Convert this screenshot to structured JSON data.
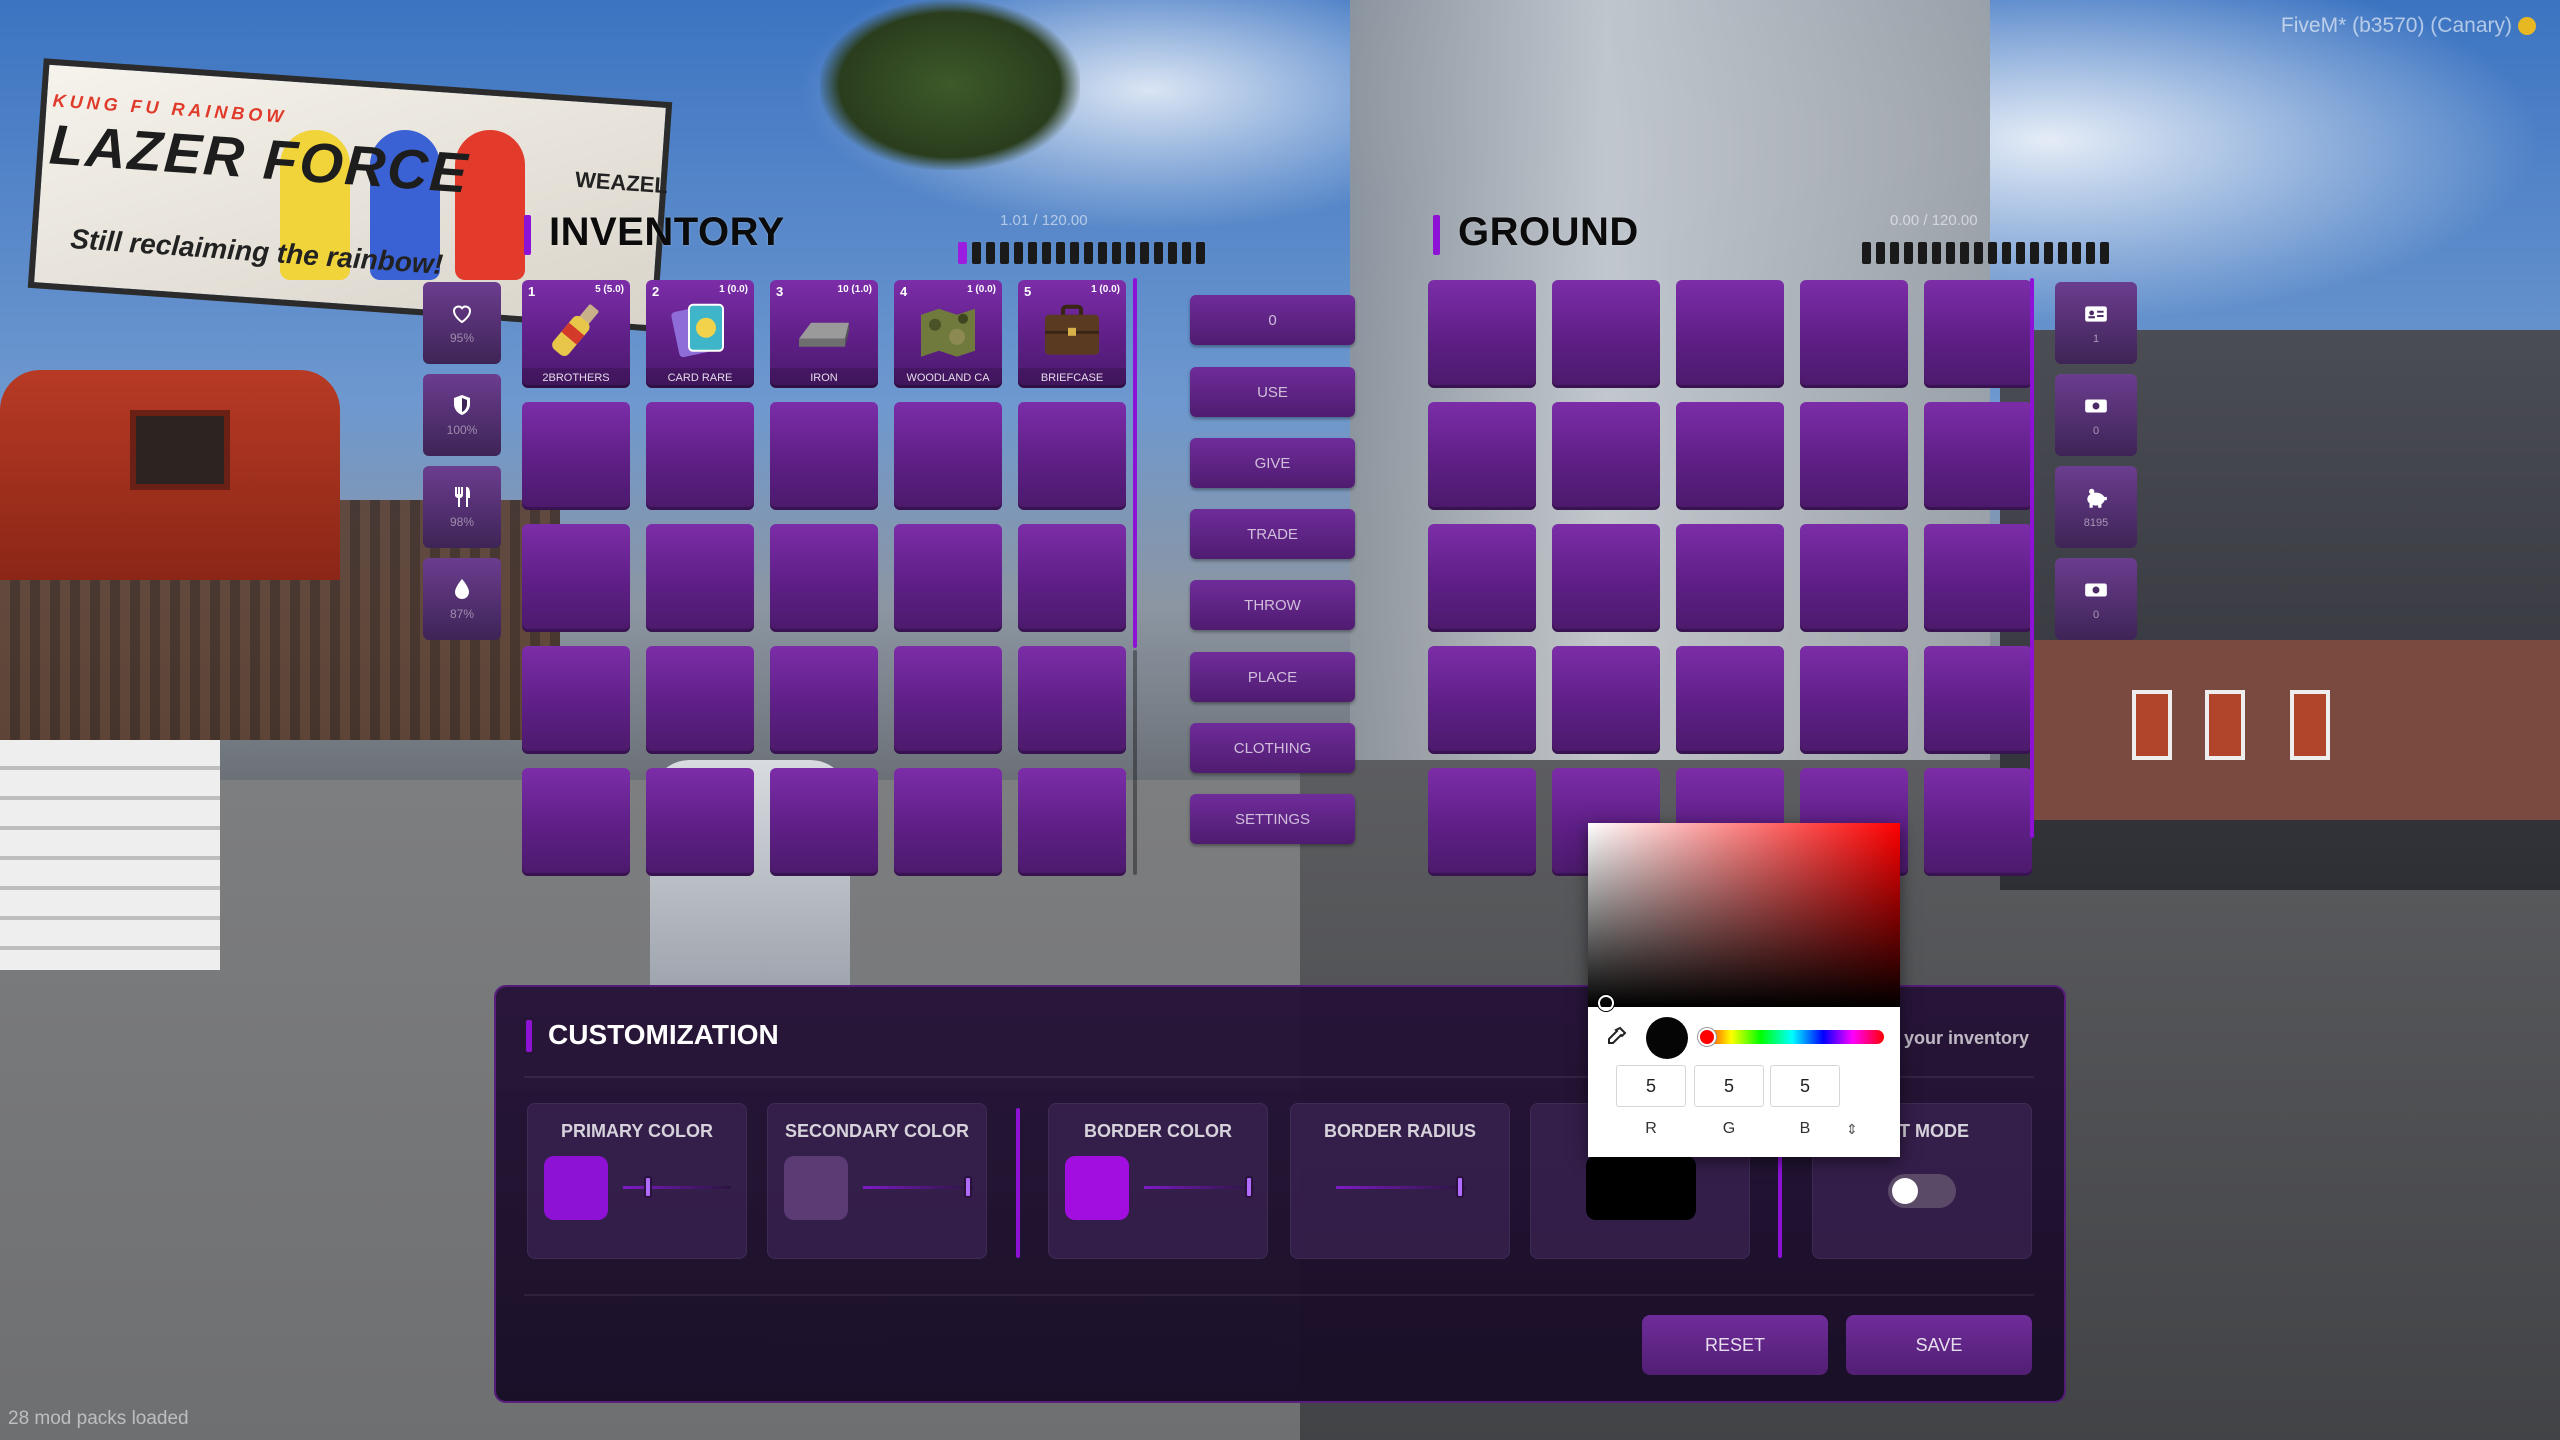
{
  "hud": {
    "version": "FiveM* (b3570) (Canary)",
    "loading_text": "28 mod packs loaded"
  },
  "billboard": {
    "logo_top": "KUNG FU RAINBOW",
    "logo": "LAZER FORCE",
    "tagline": "Still reclaiming the rainbow!",
    "brand": "WEAZEL"
  },
  "inventory": {
    "title": "INVENTORY",
    "weight": "1.01 / 120.00",
    "weight_fraction": 0.08,
    "slots": [
      {
        "num": "1",
        "count": "5 (5.0)",
        "label": "2BROTHERS",
        "icon": "bottle-icon"
      },
      {
        "num": "2",
        "count": "1 (0.0)",
        "label": "CARD RARE",
        "icon": "card-icon"
      },
      {
        "num": "3",
        "count": "10 (1.0)",
        "label": "IRON",
        "icon": "iron-ingot-icon"
      },
      {
        "num": "4",
        "count": "1 (0.0)",
        "label": "WOODLAND CA",
        "icon": "camo-map-icon"
      },
      {
        "num": "5",
        "count": "1 (0.0)",
        "label": "BRIEFCASE",
        "icon": "briefcase-icon"
      }
    ]
  },
  "stats": [
    {
      "icon": "heart-icon",
      "value": "95%"
    },
    {
      "icon": "shield-icon",
      "value": "100%"
    },
    {
      "icon": "food-icon",
      "value": "98%"
    },
    {
      "icon": "water-icon",
      "value": "87%"
    }
  ],
  "actions": {
    "amount": "0",
    "items": [
      "USE",
      "GIVE",
      "TRADE",
      "THROW",
      "PLACE",
      "CLOTHING",
      "SETTINGS"
    ]
  },
  "ground": {
    "title": "GROUND",
    "weight": "0.00 / 120.00"
  },
  "right_sidebar": [
    {
      "icon": "id-card-icon",
      "value": "1"
    },
    {
      "icon": "cash-icon",
      "value": "0"
    },
    {
      "icon": "piggy-bank-icon",
      "value": "8195"
    },
    {
      "icon": "money-icon",
      "value": "0"
    }
  ],
  "customization": {
    "title": "CUSTOMIZATION",
    "hint": "your inventory",
    "primary_label": "PRIMARY COLOR",
    "secondary_label": "SECONDARY COLOR",
    "border_label": "BORDER COLOR",
    "radius_label": "BORDER RADIUS",
    "compact_label": "ACT MODE",
    "primary_color": "#8d12d6",
    "secondary_color": "#5c3a73",
    "border_color": "#a20ee0",
    "text_color": "#000000",
    "reset_label": "RESET",
    "save_label": "SAVE"
  },
  "color_picker": {
    "r": "5",
    "g": "5",
    "b": "5",
    "r_label": "R",
    "g_label": "G",
    "b_label": "B"
  }
}
